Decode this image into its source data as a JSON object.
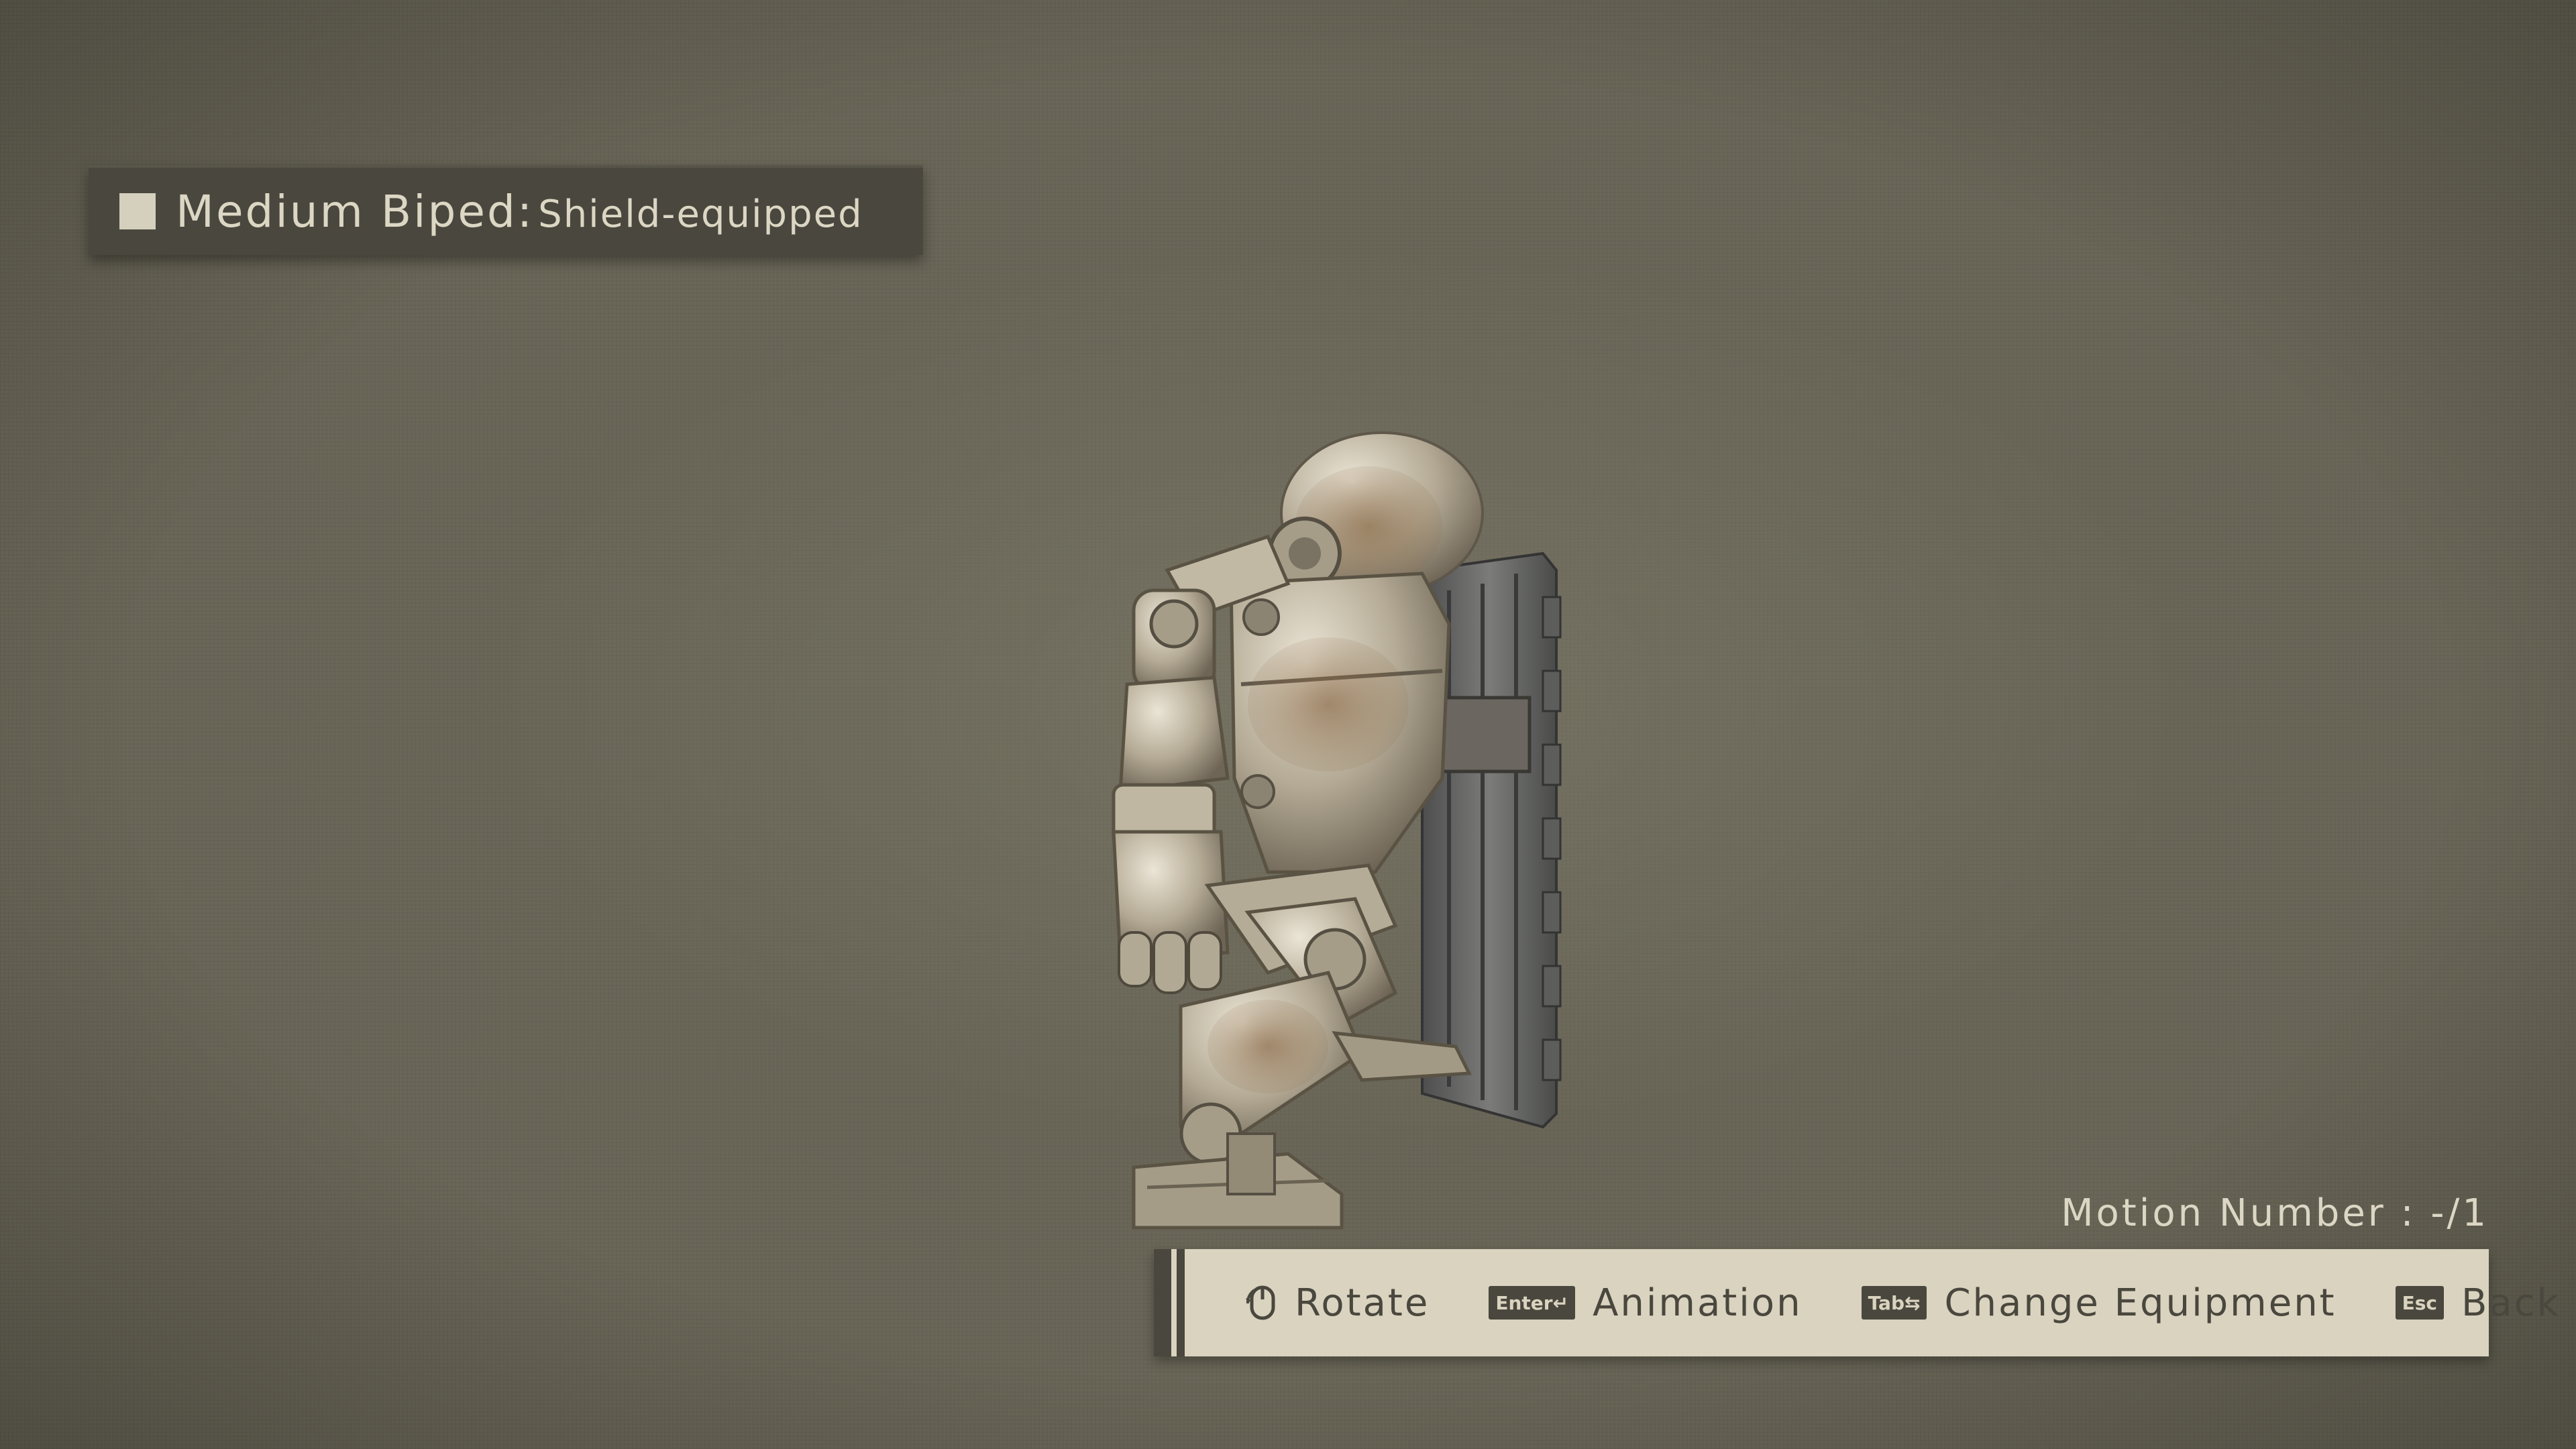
{
  "title": {
    "main": "Medium Biped:",
    "sub": "Shield-equipped"
  },
  "motion": {
    "label": "Motion Number : -/1"
  },
  "controls": [
    {
      "key": "mouse-icon",
      "label": "Rotate"
    },
    {
      "key": "Enter↵",
      "label": "Animation"
    },
    {
      "key": "Tab⇆",
      "label": "Change Equipment"
    },
    {
      "key": "Esc",
      "label": "Back"
    }
  ],
  "colors": {
    "background": "#6a6758",
    "panel_dark": "#4a473e",
    "panel_light": "#d9d3bf",
    "text_light": "#dcd7c4"
  }
}
